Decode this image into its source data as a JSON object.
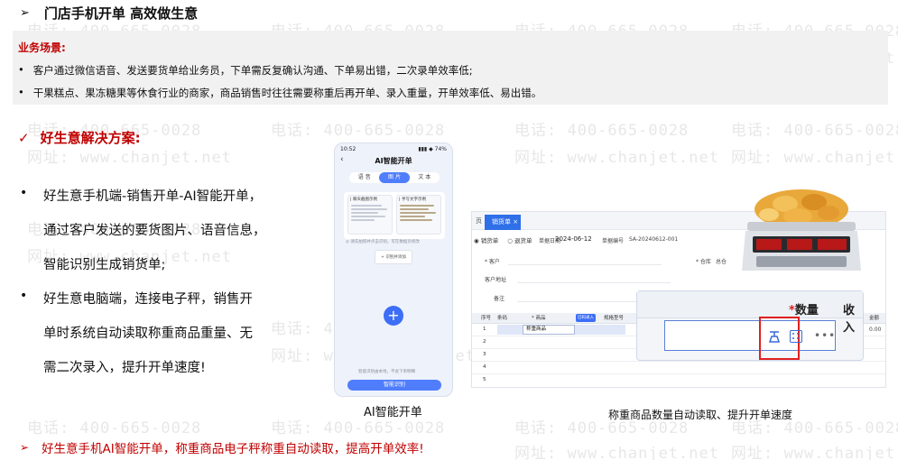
{
  "watermark": {
    "phone": "电话: 400-665-0028",
    "site": "网址: www.chanjet.net"
  },
  "header": {
    "arrow": "➢",
    "title": "门店手机开单 高效做生意"
  },
  "scenario": {
    "heading": "业务场景:",
    "bullet": "•",
    "items": [
      "客户通过微信语音、发送要货单给业务员，下单需反复确认沟通、下单易出错，二次录单效率低;",
      "干果糕点、果冻糖果等休食行业的商家，商品销售时往往需要称重后再开单、录入重量，开单效率低、易出错。"
    ]
  },
  "solution": {
    "check": "✓",
    "heading": "好生意解决方案:",
    "bullet": "•",
    "point1": [
      "好生意手机端-销售开单-AI智能开单，",
      "通过客户发送的要货图片、语音信息，",
      "智能识别生成销货单;"
    ],
    "point2": [
      "好生意电脑端，连接电子秤，销售开",
      "单时系统自动读取称重商品重量、无",
      "需二次录入，提升开单速度!"
    ]
  },
  "phone_screen": {
    "time": "10:52",
    "signal": "▮▮▮ ◆ 74%",
    "back": "‹",
    "title": "AI智能开单",
    "tabs": [
      "语 音",
      "图 片",
      "文 本"
    ],
    "active_tab": 1,
    "sample1_caption": "| 聊天截图示例",
    "sample2_caption": "| 手写文字示例",
    "hint": "◎ 请先拍照并点击识别，可在数据页修改",
    "add_label": "+ 识别并添加",
    "plus": "+",
    "tip": "智能识别由本地，不会下单明细",
    "button": "智能识别"
  },
  "phone_caption": "AI智能开单",
  "erp_screen": {
    "tab_prev": "页",
    "tab_active": "销货单 ×",
    "radio_sale": "◉ 销货单",
    "radio_return": "○ 退货单",
    "date_label": "单据日期",
    "date_value": "2024-06-12",
    "no_label": "单据编号",
    "no_value": "SA-20240612-001",
    "customer": "* 客户",
    "warehouse": "* 仓库",
    "warehouse_value": "总仓",
    "address": "客户地址",
    "remark": "备注",
    "col_row": "序号",
    "col_code": "条码",
    "col_product": "* 商品",
    "col_badge": "已码录入",
    "col_spec": "规格型号",
    "col_amount": "金额",
    "row1_product": "称重商品",
    "row1_amount": "0.00",
    "row_nums": [
      "1",
      "2",
      "3",
      "4",
      "5"
    ]
  },
  "zoom": {
    "star": "*",
    "qty_label": "数量",
    "recv_label": "收入",
    "dots": "•••"
  },
  "erp_caption": "称重商品数量自动读取、提升开单速度",
  "footer": {
    "arrow": "➢",
    "text": "好生意手机AI智能开单，称重商品电子秤称重自动读取，提高开单效率!"
  },
  "colors": {
    "accent_red": "#c00000",
    "primary_blue": "#3d6ef7",
    "highlight_red": "#e02020"
  }
}
